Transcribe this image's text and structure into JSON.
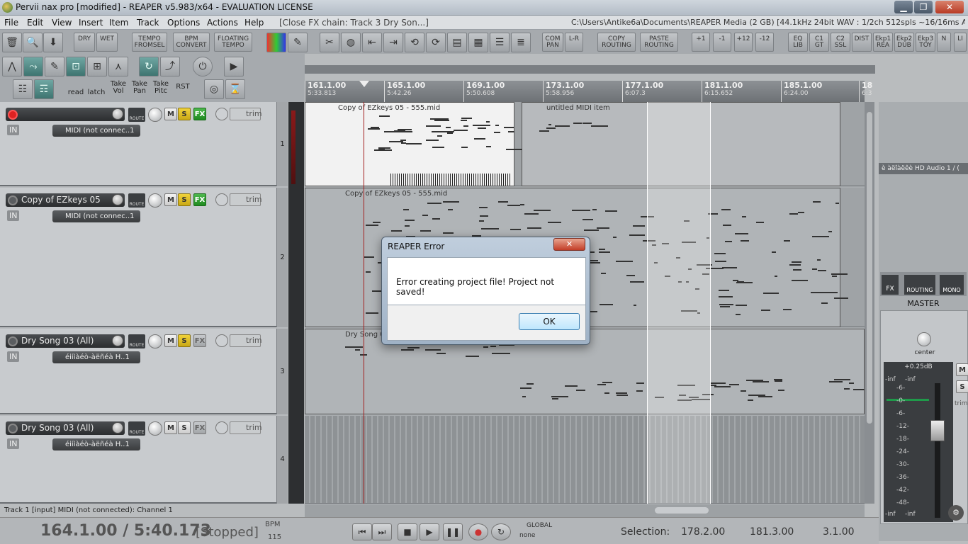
{
  "window": {
    "title": "Pervii nax pro [modified] - REAPER v5.983/x64 - EVALUATION LICENSE",
    "minimize": "▁",
    "maximize": "❐",
    "close": "✕"
  },
  "menu": {
    "items": [
      "File",
      "Edit",
      "View",
      "Insert",
      "Item",
      "Track",
      "Options",
      "Actions",
      "Help"
    ],
    "last_action": "[Close FX chain: Track 3 Dry Son...]",
    "project_info": "C:\\Users\\Antike6a\\Documents\\REAPER Media (2 GB) [44.1kHz 24bit WAV : 1/2ch 512spls ~16/16ms ASIO]"
  },
  "toolbar": {
    "buttons": [
      {
        "label": "DRY"
      },
      {
        "label": "WET"
      },
      {
        "label": "TEMPO FROMSEL"
      },
      {
        "label": "BPM CONVERT"
      },
      {
        "label": "FLOATING TEMPO"
      },
      {
        "label": "COM PAN"
      },
      {
        "label": "L-R"
      },
      {
        "label": "COPY ROUTING"
      },
      {
        "label": "PASTE ROUTING"
      },
      {
        "label": "+1"
      },
      {
        "label": "-1"
      },
      {
        "label": "+12"
      },
      {
        "label": "-12"
      },
      {
        "label": "EQ LIB"
      },
      {
        "label": "C1 GT"
      },
      {
        "label": "C2 SSL"
      },
      {
        "label": "DIST"
      },
      {
        "label": "Ekp1 REA"
      },
      {
        "label": "Ekp2 DUB"
      },
      {
        "label": "Ekp3 TOY"
      },
      {
        "label": "N"
      },
      {
        "label": "LI"
      }
    ]
  },
  "toolbar2": {
    "read": "read",
    "latch": "latch",
    "take_vol": "Take Vol",
    "take_pan": "Take Pan",
    "take_pitch": "Take Pitc",
    "rst": "RST"
  },
  "ruler": {
    "marks": [
      {
        "bar": "161.1.00",
        "time": "5:33.813"
      },
      {
        "bar": "165.1.00",
        "time": "5:42.26"
      },
      {
        "bar": "169.1.00",
        "time": "5:50.608"
      },
      {
        "bar": "173.1.00",
        "time": "5:58.956"
      },
      {
        "bar": "177.1.00",
        "time": "6:07.3"
      },
      {
        "bar": "181.1.00",
        "time": "6:15.652"
      },
      {
        "bar": "185.1.00",
        "time": "6:24.00"
      },
      {
        "bar": "18",
        "time": "6:3"
      }
    ]
  },
  "tracks": [
    {
      "number": "1",
      "name": "",
      "armed": true,
      "input": "IN",
      "midi": "MIDI (not connec..1",
      "solo": true,
      "fx": true,
      "mute": "M",
      "solo_label": "S",
      "fx_label": "FX",
      "route": "ROUTE",
      "trim": "trim"
    },
    {
      "number": "2",
      "name": "Copy of EZkeys 05",
      "armed": false,
      "input": "IN",
      "midi": "MIDI (not connec..1",
      "solo": true,
      "fx": true,
      "mute": "M",
      "solo_label": "S",
      "fx_label": "FX",
      "route": "ROUTE",
      "trim": "trim"
    },
    {
      "number": "3",
      "name": "Dry Song 03 (All)",
      "armed": false,
      "input": "IN",
      "midi": "éiiìàéò-àëñéà H..1",
      "solo": true,
      "fx": false,
      "mute": "M",
      "solo_label": "S",
      "fx_label": "FX",
      "route": "ROUTE",
      "trim": "trim"
    },
    {
      "number": "4",
      "name": "Dry Song 03 (All)",
      "armed": false,
      "input": "IN",
      "midi": "éiiìàéò-àëñéà H..1",
      "solo": false,
      "fx": false,
      "mute": "M",
      "solo_label": "S",
      "fx_label": "FX",
      "route": "ROUTE",
      "trim": "trim"
    }
  ],
  "items": [
    {
      "label": "Copy of EZkeys 05 - 555.mid"
    },
    {
      "label": "untitled MIDI item"
    },
    {
      "label": "Copy of EZkeys 05 - 555.mid"
    },
    {
      "label": "Dry Song 03"
    }
  ],
  "mixer": {
    "device": "è àëîàëêè HD Audio 1 / (",
    "fx": "FX",
    "routing": "ROUTING",
    "mono": "MONO",
    "master_label": "MASTER",
    "pan": "center",
    "peak": "+0.25dB",
    "inf_l": "-inf",
    "inf_r": "-inf",
    "scale": [
      "-6-",
      "-0-",
      "-6-",
      "-12-",
      "-18-",
      "-24-",
      "-30-",
      "-36-",
      "-42-",
      "-48-"
    ],
    "inf_bottom_l": "-inf",
    "inf_bottom_r": "-inf",
    "m": "M",
    "s": "S",
    "trim": "trim"
  },
  "status": {
    "text": "Track 1 [input] MIDI (not connected): Channel 1"
  },
  "transport": {
    "position": "164.1.00 / 5:40.173",
    "state": "[Stopped]",
    "bpm_label": "BPM",
    "bpm": "115",
    "global": "GLOBAL",
    "global_value": "none",
    "selection_label": "Selection:",
    "sel_start": "178.2.00",
    "sel_end": "181.3.00",
    "sel_length": "3.1.00"
  },
  "dialog": {
    "title": "REAPER Error",
    "message": "Error creating project file! Project not saved!",
    "ok": "OK",
    "close": "✕"
  },
  "colors": {
    "accent": "#d22222",
    "solo": "#e0c020",
    "fx_on": "#2ea02e",
    "dialog_frame": "#a7b8ca"
  }
}
